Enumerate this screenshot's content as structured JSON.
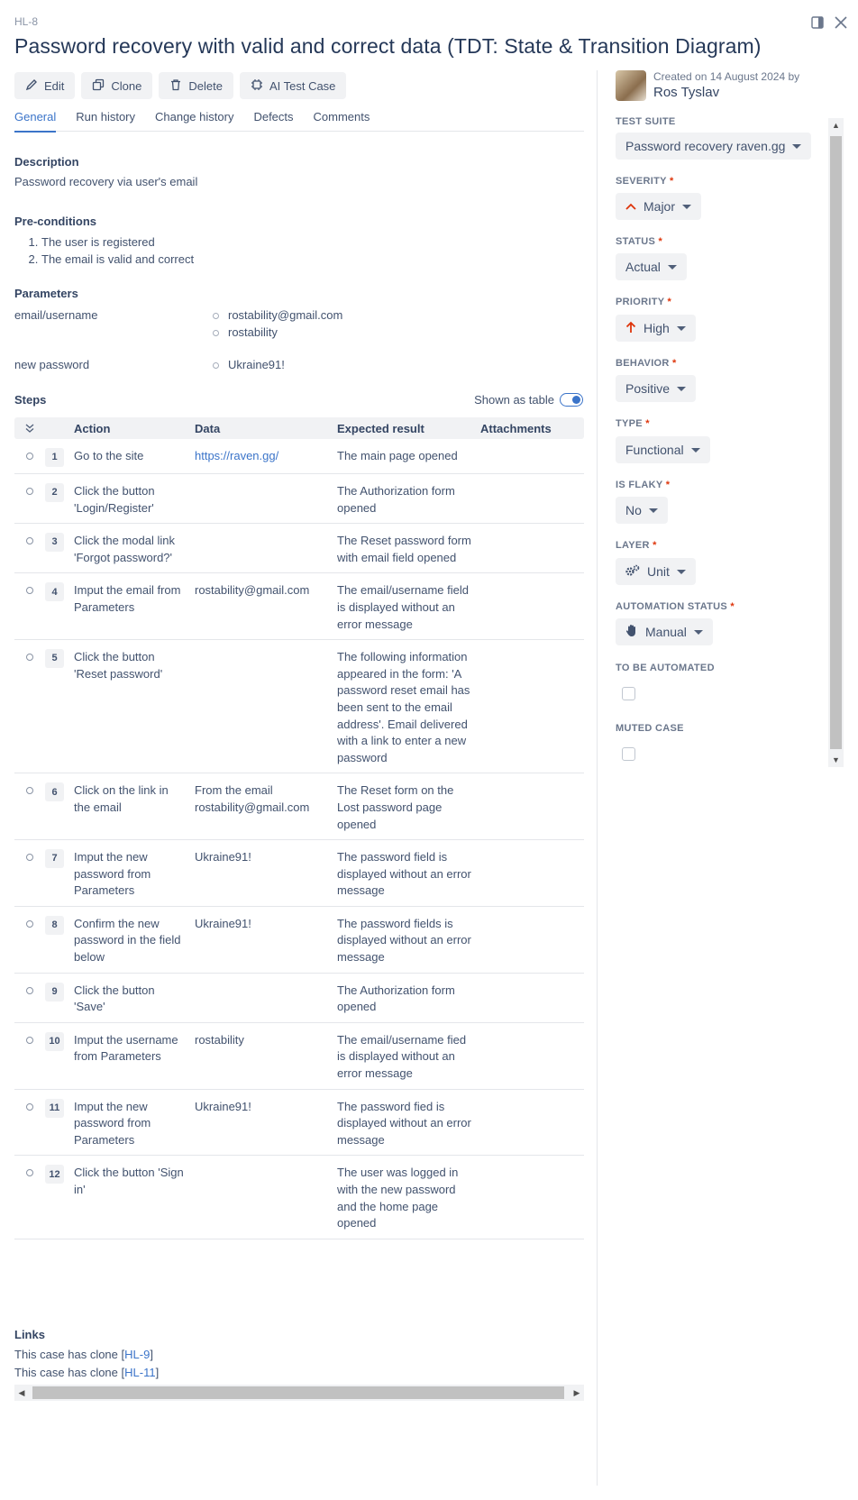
{
  "header": {
    "case_id": "HL-8",
    "title": "Password recovery with valid and correct data (TDT: State & Transition Diagram)"
  },
  "toolbar": {
    "edit": "Edit",
    "clone": "Clone",
    "delete": "Delete",
    "ai": "AI Test Case"
  },
  "tabs": [
    "General",
    "Run history",
    "Change history",
    "Defects",
    "Comments"
  ],
  "description": {
    "label": "Description",
    "text": "Password recovery via user's email"
  },
  "preconditions": {
    "label": "Pre-conditions",
    "items": [
      "The user is registered",
      "The email is valid and correct"
    ]
  },
  "parameters": {
    "label": "Parameters",
    "params": [
      {
        "name": "email/username",
        "values": [
          "rostability@gmail.com",
          "rostability"
        ]
      },
      {
        "name": "new password",
        "values": [
          "Ukraine91!"
        ]
      }
    ]
  },
  "steps": {
    "label": "Steps",
    "shown_as_table": "Shown as table",
    "headers": {
      "action": "Action",
      "data": "Data",
      "expected": "Expected result",
      "attachments": "Attachments"
    },
    "rows": [
      {
        "num": "1",
        "action": "Go to the site",
        "data": "https://raven.gg/",
        "data_link": true,
        "expected": "The main page opened"
      },
      {
        "num": "2",
        "action": "Click the button 'Login/Register'",
        "data": "",
        "expected": "The Authorization form opened"
      },
      {
        "num": "3",
        "action": "Click the modal link 'Forgot password?'",
        "data": "",
        "expected": "The Reset password form with email field opened"
      },
      {
        "num": "4",
        "action": "Imput the email from Parameters",
        "data": "rostability@gmail.com",
        "expected": "The email/username field is displayed without an error message"
      },
      {
        "num": "5",
        "action": "Click the button 'Reset password'",
        "data": "",
        "expected": "The following information appeared in the form: 'A password reset email has been sent to the email address'. Email delivered with a link to enter a new password"
      },
      {
        "num": "6",
        "action": "Click on the link in the email",
        "data": "From the email rostability@gmail.com",
        "expected": "The Reset form on the Lost password page opened"
      },
      {
        "num": "7",
        "action": "Imput the new password from Parameters",
        "data": "Ukraine91!",
        "expected": "The password field is displayed without an error message"
      },
      {
        "num": "8",
        "action": "Confirm the new password in the field below",
        "data": "Ukraine91!",
        "expected": "The password fields is displayed without an error message"
      },
      {
        "num": "9",
        "action": "Click the button 'Save'",
        "data": "",
        "expected": "The Authorization form opened"
      },
      {
        "num": "10",
        "action": "Imput the username from Parameters",
        "data": "rostability",
        "expected": "The email/username fied is displayed without an error message"
      },
      {
        "num": "11",
        "action": "Imput the new password from Parameters",
        "data": "Ukraine91!",
        "expected": "The password fied is displayed without an error message"
      },
      {
        "num": "12",
        "action": "Click the button 'Sign in'",
        "data": "",
        "expected": "The user was logged in with the new password and the home page opened"
      }
    ]
  },
  "links": {
    "label": "Links",
    "items": [
      {
        "prefix": "This case has clone [",
        "id": "HL-9",
        "suffix": "]"
      },
      {
        "prefix": "This case has clone [",
        "id": "HL-11",
        "suffix": "]"
      }
    ]
  },
  "sidebar": {
    "created": "Created on 14 August 2024 by",
    "author": "Ros Tyslav",
    "test_suite": {
      "label": "TEST SUITE",
      "value": "Password recovery raven.gg"
    },
    "severity": {
      "label": "SEVERITY",
      "value": "Major",
      "icon": "chevron-up-icon",
      "color": "#de350b"
    },
    "status": {
      "label": "STATUS",
      "value": "Actual"
    },
    "priority": {
      "label": "PRIORITY",
      "value": "High",
      "icon": "arrow-up-icon",
      "color": "#de350b"
    },
    "behavior": {
      "label": "BEHAVIOR",
      "value": "Positive"
    },
    "type": {
      "label": "TYPE",
      "value": "Functional"
    },
    "is_flaky": {
      "label": "IS FLAKY",
      "value": "No"
    },
    "layer": {
      "label": "LAYER",
      "value": "Unit",
      "icon": "gears-icon"
    },
    "automation_status": {
      "label": "AUTOMATION STATUS",
      "value": "Manual",
      "icon": "hand-icon"
    },
    "to_be_automated": {
      "label": "TO BE AUTOMATED",
      "checked": false
    },
    "muted_case": {
      "label": "MUTED CASE",
      "checked": false
    }
  },
  "colors": {
    "accent": "#3b74c9",
    "required": "#de350b"
  }
}
